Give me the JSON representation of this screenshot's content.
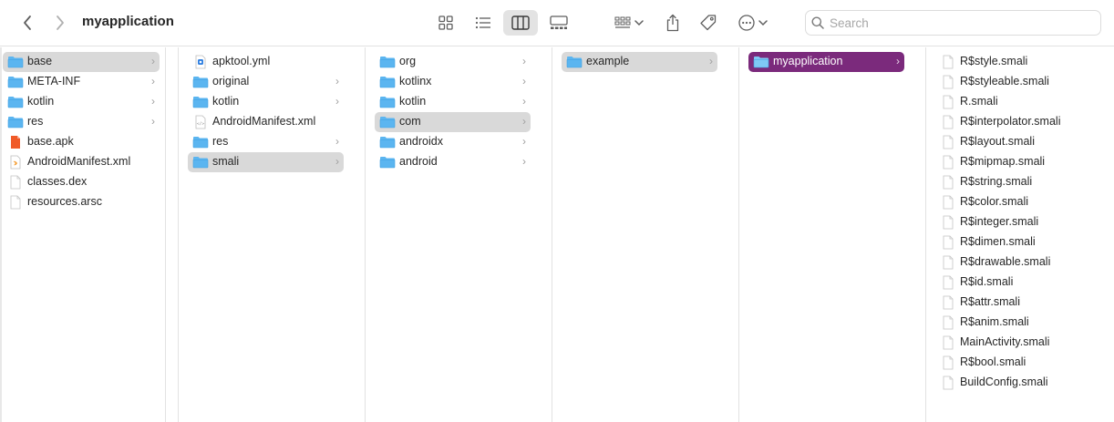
{
  "window": {
    "title": "myapplication"
  },
  "search": {
    "placeholder": "Search"
  },
  "toolbar": {
    "back_icon": "chevron-left-icon",
    "forward_icon": "chevron-right-icon",
    "views": [
      "icon-view",
      "list-view",
      "column-view",
      "gallery-view"
    ],
    "active_view": "column-view"
  },
  "colors": {
    "selection_active": "#7b2a7c",
    "selection_inactive": "#d9d9d9",
    "folder": "#5bb5f0"
  },
  "columns": [
    {
      "items": [
        {
          "name": "base",
          "type": "folder",
          "chevron": true,
          "selected": "inactive"
        },
        {
          "name": "META-INF",
          "type": "folder",
          "chevron": true
        },
        {
          "name": "kotlin",
          "type": "folder",
          "chevron": true
        },
        {
          "name": "res",
          "type": "folder",
          "chevron": true
        },
        {
          "name": "base.apk",
          "type": "apk"
        },
        {
          "name": "AndroidManifest.xml",
          "type": "xml-swift"
        },
        {
          "name": "classes.dex",
          "type": "file"
        },
        {
          "name": "resources.arsc",
          "type": "file"
        }
      ]
    },
    {
      "items": [
        {
          "name": "apktool.yml",
          "type": "yml"
        },
        {
          "name": "original",
          "type": "folder",
          "chevron": true
        },
        {
          "name": "kotlin",
          "type": "folder",
          "chevron": true
        },
        {
          "name": "AndroidManifest.xml",
          "type": "xml"
        },
        {
          "name": "res",
          "type": "folder",
          "chevron": true
        },
        {
          "name": "smali",
          "type": "folder",
          "chevron": true,
          "selected": "inactive"
        }
      ]
    },
    {
      "items": [
        {
          "name": "org",
          "type": "folder",
          "chevron": true
        },
        {
          "name": "kotlinx",
          "type": "folder",
          "chevron": true
        },
        {
          "name": "kotlin",
          "type": "folder",
          "chevron": true
        },
        {
          "name": "com",
          "type": "folder",
          "chevron": true,
          "selected": "inactive"
        },
        {
          "name": "androidx",
          "type": "folder",
          "chevron": true
        },
        {
          "name": "android",
          "type": "folder",
          "chevron": true
        }
      ]
    },
    {
      "items": [
        {
          "name": "example",
          "type": "folder",
          "chevron": true,
          "selected": "inactive"
        }
      ]
    },
    {
      "items": [
        {
          "name": "myapplication",
          "type": "folder",
          "chevron": true,
          "selected": "active"
        }
      ]
    },
    {
      "items": [
        {
          "name": "R$style.smali",
          "type": "file"
        },
        {
          "name": "R$styleable.smali",
          "type": "file"
        },
        {
          "name": "R.smali",
          "type": "file"
        },
        {
          "name": "R$interpolator.smali",
          "type": "file"
        },
        {
          "name": "R$layout.smali",
          "type": "file"
        },
        {
          "name": "R$mipmap.smali",
          "type": "file"
        },
        {
          "name": "R$string.smali",
          "type": "file"
        },
        {
          "name": "R$color.smali",
          "type": "file"
        },
        {
          "name": "R$integer.smali",
          "type": "file"
        },
        {
          "name": "R$dimen.smali",
          "type": "file"
        },
        {
          "name": "R$drawable.smali",
          "type": "file"
        },
        {
          "name": "R$id.smali",
          "type": "file"
        },
        {
          "name": "R$attr.smali",
          "type": "file"
        },
        {
          "name": "R$anim.smali",
          "type": "file"
        },
        {
          "name": "MainActivity.smali",
          "type": "file"
        },
        {
          "name": "R$bool.smali",
          "type": "file"
        },
        {
          "name": "BuildConfig.smali",
          "type": "file"
        }
      ]
    }
  ]
}
